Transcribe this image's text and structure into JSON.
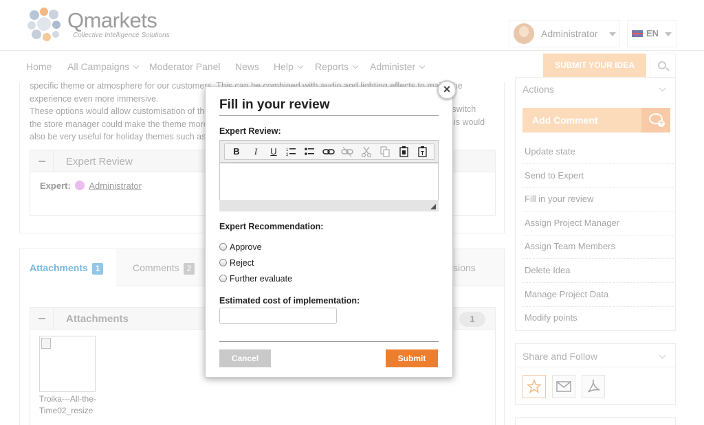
{
  "header": {
    "logo_text": "Qmarkets",
    "logo_tagline": "Collective Intelligence Solutions",
    "user_name": "Administrator",
    "language": "EN",
    "submit_idea_label": "SUBMIT YOUR IDEA"
  },
  "nav": {
    "items": [
      {
        "label": "Home"
      },
      {
        "label": "All Campaigns"
      },
      {
        "label": "Moderator Panel"
      },
      {
        "label": "News"
      },
      {
        "label": "Help"
      },
      {
        "label": "Reports"
      },
      {
        "label": "Administer"
      }
    ]
  },
  "content": {
    "description_lines": [
      "specific theme or atmosphere for our customers. This can be combined with audio and lighting effects to make the",
      "experience even more immersive.",
      "These options would allow customisation of the",
      "the store manager could make the theme more",
      "also be very useful for holiday themes such as"
    ],
    "description_right": [
      "a switch",
      "his would"
    ],
    "expert_panel_title": "Expert Review",
    "expert_label": "Expert:",
    "expert_name": "Administrator",
    "tabs": [
      {
        "label": "Attachments",
        "count": "1"
      },
      {
        "label": "Comments",
        "count": "2"
      },
      {
        "label": "sions"
      }
    ],
    "attachments_panel_title": "Attachments",
    "attachments_count": "1",
    "attachment_caption": "Troika---All-the-Time02_resize"
  },
  "sidebar": {
    "actions_title": "Actions",
    "add_comment_label": "Add Comment",
    "actions": [
      "Update state",
      "Send to Expert",
      "Fill in your review",
      "Assign Project Manager",
      "Assign Team Members",
      "Delete Idea",
      "Manage Project Data",
      "Modify points"
    ],
    "share_title": "Share and Follow"
  },
  "modal": {
    "title": "Fill in your review",
    "close_glyph": "×",
    "expert_review_label": "Expert Review:",
    "toolbar": [
      "B",
      "I",
      "U"
    ],
    "recommendation_label": "Expert Recommendation:",
    "options": [
      "Approve",
      "Reject",
      "Further evaluate"
    ],
    "cost_label": "Estimated cost of implementation:",
    "cost_value": "",
    "cancel_label": "Cancel",
    "submit_label": "Submit"
  },
  "colors": {
    "accent": "#ed7e2d",
    "accent_light": "#fbcfa5",
    "link_blue": "#4a9fd5"
  }
}
